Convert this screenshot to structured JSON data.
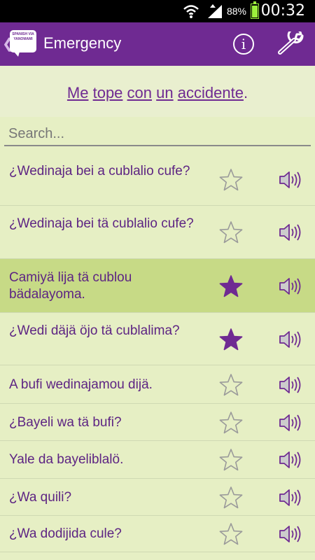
{
  "status_bar": {
    "battery_percent": "88%",
    "time": "00:32",
    "icons": [
      "wifi-icon",
      "signal-icon",
      "battery-icon"
    ]
  },
  "app_bar": {
    "title": "Emergency",
    "logo_text": "SPANISH VIA YANOMAMI",
    "info_icon": "i",
    "back_icon": "❮",
    "accent_color": "#6f2a92"
  },
  "sentence": {
    "words": [
      "Me",
      "tope",
      "con",
      "un",
      "accidente"
    ],
    "end_punct": "."
  },
  "search": {
    "placeholder": "Search...",
    "value": ""
  },
  "phrases": [
    {
      "text": "¿Wedinaja bei a cublalio cufe?",
      "favorite": false,
      "highlighted": false
    },
    {
      "text": "¿Wedinaja bei tä cublalio cufe?",
      "favorite": false,
      "highlighted": false
    },
    {
      "text": "Camiyä lija tä cublou bädalayoma.",
      "favorite": true,
      "highlighted": true
    },
    {
      "text": "¿Wedi däjä öjo tä cublalima?",
      "favorite": true,
      "highlighted": false
    },
    {
      "text": "A bufi wedinajamou dijä.",
      "favorite": false,
      "highlighted": false
    },
    {
      "text": "¿Bayeli wa tä bufi?",
      "favorite": false,
      "highlighted": false
    },
    {
      "text": "Yale da bayeliblalö.",
      "favorite": false,
      "highlighted": false
    },
    {
      "text": "¿Wa quili?",
      "favorite": false,
      "highlighted": false
    },
    {
      "text": "¿Wa dodijida cule?",
      "favorite": false,
      "highlighted": false
    }
  ]
}
